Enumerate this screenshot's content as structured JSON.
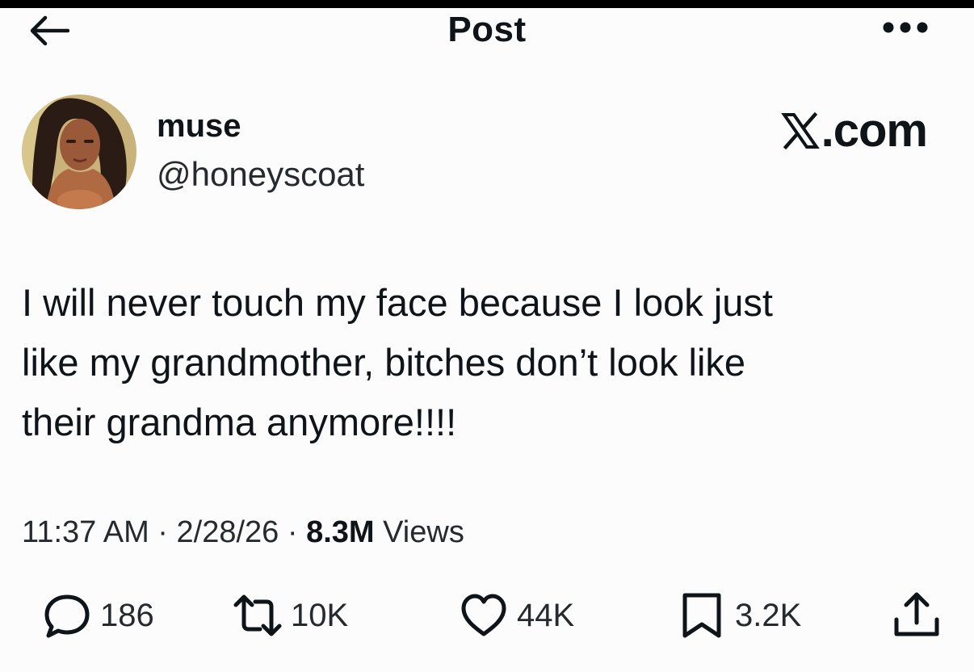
{
  "header": {
    "title": "Post",
    "back_icon": "arrow-left-icon",
    "more_icon": "more-horizontal-icon"
  },
  "author": {
    "display_name": "muse",
    "handle": "@honeyscoat"
  },
  "brand": {
    "label": ".com",
    "icon": "x-logo-icon"
  },
  "post": {
    "lines": [
      "I will never touch my face because I look just",
      "like my grandmother, bitches don’t look like",
      "their grandma anymore!!!!"
    ]
  },
  "meta": {
    "time": "11:37 AM",
    "sep1": " · ",
    "date": "2/28/26",
    "sep2": " · ",
    "views_count": "8.3M",
    "views_label": " Views"
  },
  "actions": {
    "replies": "186",
    "reposts": "10K",
    "likes": "44K",
    "bookmarks": "3.2K"
  },
  "colors": {
    "background": "#fcfcfc",
    "text": "#0f1419",
    "secondary_text": "#26292d"
  }
}
